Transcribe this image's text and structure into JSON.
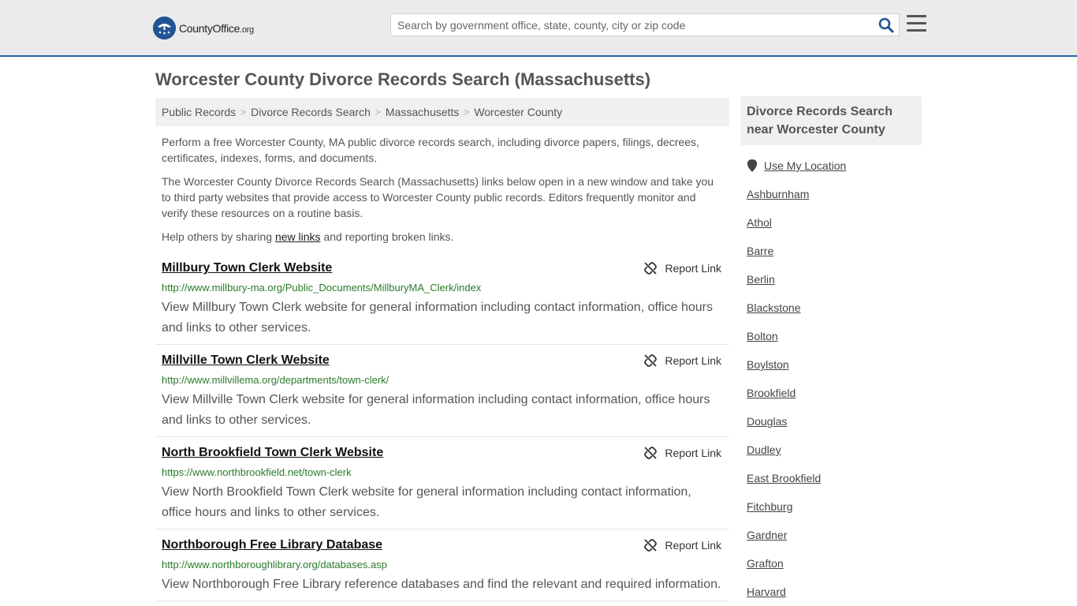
{
  "header": {
    "logo_text_main": "CountyOffice",
    "logo_text_org": ".org",
    "search_placeholder": "Search by government office, state, county, city or zip code"
  },
  "page": {
    "title": "Worcester County Divorce Records Search (Massachusetts)"
  },
  "breadcrumb": [
    "Public Records",
    "Divorce Records Search",
    "Massachusetts",
    "Worcester County"
  ],
  "intro": {
    "p1": "Perform a free Worcester County, MA public divorce records search, including divorce papers, filings, decrees, certificates, indexes, forms, and documents.",
    "p2": "The Worcester County Divorce Records Search (Massachusetts) links below open in a new window and take you to third party websites that provide access to Worcester County public records. Editors frequently monitor and verify these resources on a routine basis.",
    "p3_before": "Help others by sharing ",
    "p3_link": "new links",
    "p3_after": " and reporting broken links."
  },
  "report_label": "Report Link",
  "results": [
    {
      "title": "Millbury Town Clerk Website",
      "url": "http://www.millbury-ma.org/Public_Documents/MillburyMA_Clerk/index",
      "desc": "View Millbury Town Clerk website for general information including contact information, office hours and links to other services."
    },
    {
      "title": "Millville Town Clerk Website",
      "url": "http://www.millvillema.org/departments/town-clerk/",
      "desc": "View Millville Town Clerk website for general information including contact information, office hours and links to other services."
    },
    {
      "title": "North Brookfield Town Clerk Website",
      "url": "https://www.northbrookfield.net/town-clerk",
      "desc": "View North Brookfield Town Clerk website for general information including contact information, office hours and links to other services."
    },
    {
      "title": "Northborough Free Library Database",
      "url": "http://www.northboroughlibrary.org/databases.asp",
      "desc": "View Northborough Free Library reference databases and find the relevant and required information."
    }
  ],
  "sidebar": {
    "heading": "Divorce Records Search near Worcester County",
    "use_location": "Use My Location",
    "towns": [
      "Ashburnham",
      "Athol",
      "Barre",
      "Berlin",
      "Blackstone",
      "Bolton",
      "Boylston",
      "Brookfield",
      "Douglas",
      "Dudley",
      "East Brookfield",
      "Fitchburg",
      "Gardner",
      "Grafton",
      "Harvard"
    ]
  },
  "colors": {
    "accent": "#2a62a0",
    "url_green": "#2a7b2a",
    "logo_blue": "#215493"
  }
}
